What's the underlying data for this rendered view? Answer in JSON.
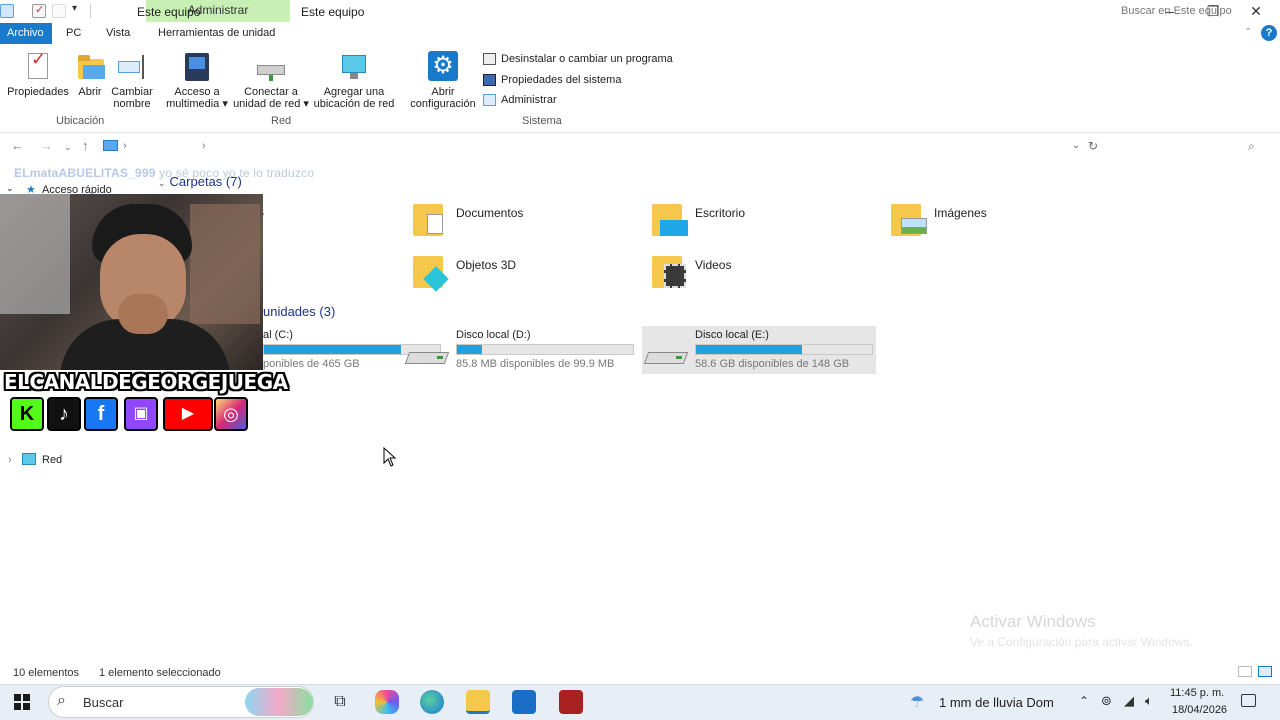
{
  "titlebar": {
    "contextual_tab": "Administrar",
    "title": "Este equipo"
  },
  "ribbon_tabs": [
    "Archivo",
    "PC",
    "Vista",
    "Herramientas de unidad"
  ],
  "ribbon": {
    "location": {
      "buttons": [
        {
          "line1": "Propiedades",
          "line2": ""
        },
        {
          "line1": "Abrir",
          "line2": ""
        },
        {
          "line1": "Cambiar",
          "line2": "nombre"
        }
      ],
      "label": "Ubicación"
    },
    "network": {
      "buttons": [
        {
          "line1": "Acceso a",
          "line2": "multimedia ▾"
        },
        {
          "line1": "Conectar a",
          "line2": "unidad de red ▾"
        },
        {
          "line1": "Agregar una",
          "line2": "ubicación de red"
        }
      ],
      "label": "Red"
    },
    "system": {
      "open_settings": {
        "line1": "Abrir",
        "line2": "configuración"
      },
      "items": [
        "Desinstalar o cambiar un programa",
        "Propiedades del sistema",
        "Administrar"
      ],
      "label": "Sistema"
    }
  },
  "address": {
    "path": "Este equipo",
    "search_placeholder": "Buscar en Este equipo"
  },
  "nav_pane": {
    "quick_access": "Acceso rápido",
    "network": "Red"
  },
  "content": {
    "folders_heading": "Carpetas (7)",
    "folders": [
      "Documentos",
      "Escritorio",
      "Imágenes",
      "Objetos 3D",
      "Videos"
    ],
    "folder_partial_label": "s",
    "drives_heading": "unidades (3)",
    "drives": [
      {
        "name": "al (C:)",
        "free": "ponibles de 465 GB",
        "used_fraction": 0.78
      },
      {
        "name": "Disco local (D:)",
        "free": "85.8 MB disponibles de 99.9 MB",
        "used_fraction": 0.14
      },
      {
        "name": "Disco local (E:)",
        "free": "58.6 GB disponibles de 148 GB",
        "used_fraction": 0.6
      }
    ]
  },
  "overlay": {
    "chat_user": "ELmataABUELITAS_999",
    "chat_message": "yo sé poco yo te lo traduzco",
    "channel_name": "ELCANALDEGEORGEJUEGA"
  },
  "statusbar": {
    "items_count": "10 elementos",
    "selected": "1 elemento seleccionado"
  },
  "watermark": {
    "title": "Activar Windows",
    "subtitle": "Ve a Configuración para activar Windows."
  },
  "taskbar": {
    "search_placeholder": "Buscar",
    "weather": "1 mm de lluvia Dom",
    "time": "11:45 p. m.",
    "date": "18/04/2026"
  },
  "colors": {
    "accent": "#1979ca",
    "drive_fill": "#26a0da",
    "contextual_tab": "#c8f0b4",
    "folder": "#f5c84c"
  }
}
